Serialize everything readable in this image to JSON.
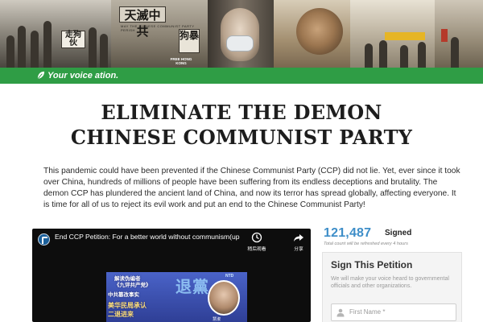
{
  "banner": {
    "sign_a": "走狗 伙",
    "sign_b": "天滅中共",
    "sign_b_sub": "May the Chinese Communist Party perish",
    "sign_c": "狗暴",
    "free_hk": "FREE HONG KONG"
  },
  "tagline": {
    "icon": "leaf-icon",
    "text": "Your voice    ation."
  },
  "title": {
    "line1": "ELIMINATE THE DEMON",
    "line2": "CHINESE COMMUNIST PARTY"
  },
  "body": {
    "paragraph": "This pandemic could have been prevented if the Chinese Communist Party (CCP) did not lie. Yet, ever since it took over China, hundreds of millions of people have been suffering from its endless deceptions and brutality. The demon CCP has plundered the ancient land of China, and now its terror has spread globally, affecting everyone. It is time for all of us to reject its evil work and put an end to the Chinese Communist Party!"
  },
  "video": {
    "title": "End CCP Petition: For a better world without communism(updated)",
    "watch_later_label": "稍后观看",
    "share_label": "分享",
    "thumbnail": {
      "line1": "解读伪编者",
      "line2": "《九评共产党》",
      "line3": "中共篡改事实",
      "line4": "美华民局承认",
      "line5": "二退进来",
      "big": "退黨",
      "ntd": "NTD",
      "anchor_name": "慧淑"
    }
  },
  "counter": {
    "count": "121,487",
    "signed_label": "Signed",
    "note": "Total count will be refreshed every 4 hours"
  },
  "sign_form": {
    "title": "Sign This Petition",
    "subtitle": "We will make your voice heard to governmental officials and other organizations.",
    "first_name_placeholder": "First Name *"
  },
  "colors": {
    "green_bar": "#2f9d45",
    "count_blue": "#3e8ec8",
    "video_bg": "#0d0d0d"
  }
}
